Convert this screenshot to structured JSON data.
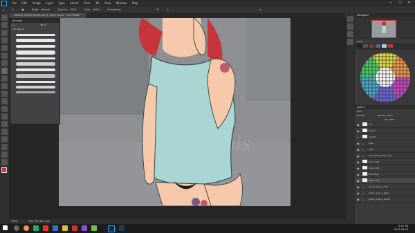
{
  "app": {
    "menu": [
      "File",
      "Edit",
      "Image",
      "Layer",
      "Type",
      "Select",
      "Filter",
      "3D",
      "View",
      "Window",
      "Help"
    ],
    "window_controls": [
      "—",
      "□",
      "✕"
    ]
  },
  "options_bar": {
    "mode_label": "Mode:",
    "mode_value": "Normal",
    "opacity_label": "Opacity:",
    "opacity_value": "100%",
    "flow_label": "Flow:",
    "flow_value": "100%",
    "smoothing_label": "Smoothing:"
  },
  "document_tab": {
    "title": "ZINARU GRACE HERM.psd @ 100% (Layer 734, RGB/8) *"
  },
  "brushes_panel": {
    "title": "Brushes",
    "size_value": "35 px",
    "folder": "Brushes 2"
  },
  "status_bar": {
    "zoom": "100%",
    "doc_info": "Doc: 58.7M/1.20G"
  },
  "navigator": {
    "title": "Navigator",
    "zoom": "100%"
  },
  "layers_panel": {
    "title": "Layers",
    "kind_label": "Kind",
    "blend_mode": "Normal",
    "opacity_label": "Opacity:",
    "opacity_value": "100%",
    "fill_label": "Fill:",
    "fill_value": "100%",
    "layers": [
      {
        "name": "line",
        "visible": true
      },
      {
        "name": "lineart",
        "visible": true
      },
      {
        "name": "overlay",
        "visible": false
      },
      {
        "name": "lines",
        "visible": true
      },
      {
        "name": "color",
        "visible": true
      },
      {
        "name": "final_white_shirt_n_pry",
        "visible": true
      },
      {
        "name": "hair & skin",
        "visible": true
      },
      {
        "name": "hair & skin",
        "visible": true
      },
      {
        "name": "shirt base",
        "visible": true
      },
      {
        "name": "Layer 734",
        "visible": true
      },
      {
        "name": "green_area_a_final",
        "visible": true
      },
      {
        "name": "green_area_a_base",
        "visible": true
      },
      {
        "name": "green_area_b_shade",
        "visible": true
      }
    ]
  },
  "taskbar": {
    "time": "4:03 PM",
    "date": "2019-06-18"
  },
  "colors": {
    "hair": "#c7343b",
    "shirt": "#a9d6d3",
    "skin": "#f6c9ab",
    "flower_pink": "#c05a6a"
  }
}
